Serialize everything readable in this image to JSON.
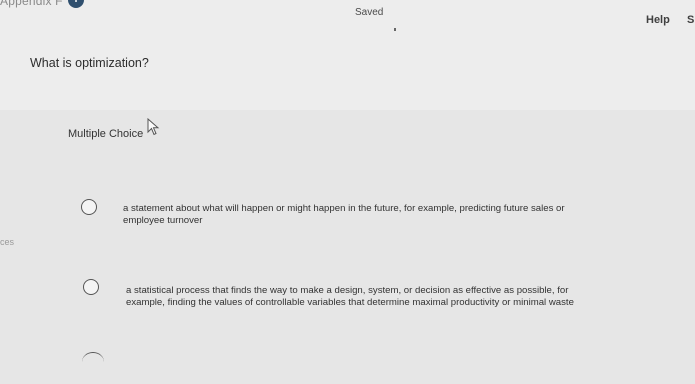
{
  "header": {
    "appendix_label": "Appendix F",
    "info_icon_text": "i",
    "save_status": "Saved",
    "help_label": "Help",
    "next_label_partial": "S"
  },
  "question": {
    "prompt": "What is optimization?",
    "type_label": "Multiple Choice"
  },
  "margin_fragment": "ces",
  "options": [
    {
      "line1": "a statement about what will happen or might happen in the future, for example, predicting future sales or",
      "line2": "employee turnover"
    },
    {
      "line1": "a statistical process that finds the way to make a design, system, or decision as effective as possible, for",
      "line2": "example, finding the values of controllable variables that determine maximal productivity or minimal waste"
    }
  ]
}
